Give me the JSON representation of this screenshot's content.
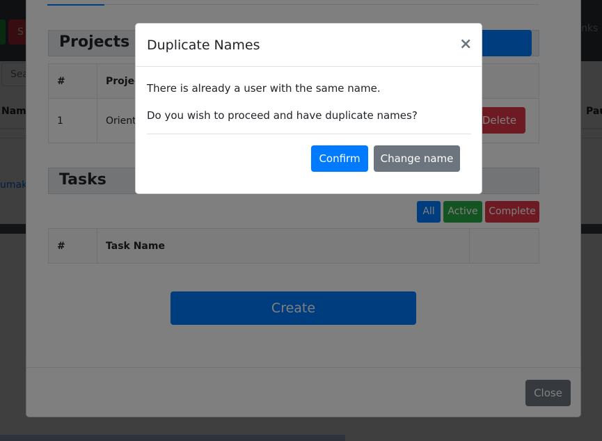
{
  "app": {
    "topbar_button": "S",
    "topbar_links": "nks",
    "search_placeholder": "Sea",
    "col_left": "Nam",
    "col_right": "Pau",
    "link_text": "umaki"
  },
  "projects": {
    "heading": "Projects",
    "columns": [
      "#",
      "Projec"
    ],
    "rows": [
      {
        "index": "1",
        "name": "Orient"
      }
    ],
    "delete_label": "Delete"
  },
  "tasks": {
    "heading": "Tasks",
    "filters": {
      "all": "All",
      "active": "Active",
      "complete": "Complete"
    },
    "columns": [
      "#",
      "Task Name",
      ""
    ]
  },
  "create_label": "Create",
  "close_label": "Close",
  "dialog": {
    "title": "Duplicate Names",
    "close_symbol": "×",
    "message1": "There is already a user with the same name.",
    "message2": "Do you wish to proceed and have duplicate names?",
    "confirm_label": "Confirm",
    "change_label": "Change name"
  },
  "colors": {
    "primary": "#007bff",
    "success": "#28a745",
    "danger": "#dc3545",
    "secondary": "#6c757d"
  }
}
